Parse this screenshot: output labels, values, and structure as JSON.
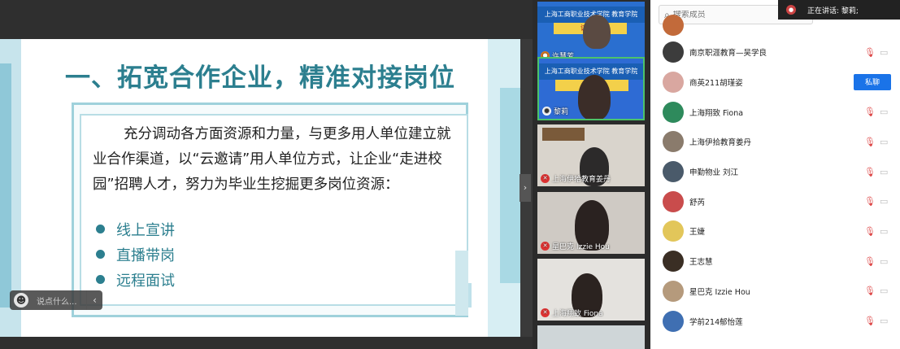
{
  "slide": {
    "title": "一、拓宽合作企业，精准对接岗位",
    "paragraph": "充分调动各方面资源和力量，与更多用人单位建立就业合作渠道，以“云邀请”用人单位方式，让企业“走进校园”招聘人才，努力为毕业生挖掘更多岗位资源：",
    "bullets": [
      "线上宣讲",
      "直播带岗",
      "远程面试"
    ]
  },
  "chat": {
    "placeholder": "说点什么..."
  },
  "videos": [
    {
      "name": "许慧芳",
      "banner": "上海工商职业技术学院 教育学院",
      "banner2": "访企业"
    },
    {
      "name": "黎莉",
      "banner": "上海工商职业技术学院 教育学院",
      "banner2": "访企业"
    },
    {
      "name": "上海伊拾教育姜丹"
    },
    {
      "name": "星巴克 Izzie Hou"
    },
    {
      "name": "上海翔致 Fiona"
    }
  ],
  "members_panel": {
    "search_placeholder": "搜索成员",
    "speaking": "正在讲话: 黎莉;",
    "private_chat_label": "私聊",
    "members": [
      {
        "name": "南京职涯教育—吴学良",
        "color": "#3c3c3c"
      },
      {
        "name": "商英211胡瑾姿",
        "color": "#d9a7a0",
        "chat": true
      },
      {
        "name": "上海翔致 Fiona",
        "color": "#2e8a5c"
      },
      {
        "name": "上海伊拾教育姜丹",
        "color": "#8a7b6c"
      },
      {
        "name": "申勤物业 刘江",
        "color": "#4a5a6a"
      },
      {
        "name": "舒芮",
        "color": "#c94c4c"
      },
      {
        "name": "王婕",
        "color": "#e2c65a"
      },
      {
        "name": "王志慧",
        "color": "#3a2e24"
      },
      {
        "name": "星巴克 Izzie Hou",
        "color": "#b59a7c"
      },
      {
        "name": "学前214郁怡莲",
        "color": "#3f6fb2"
      }
    ]
  }
}
